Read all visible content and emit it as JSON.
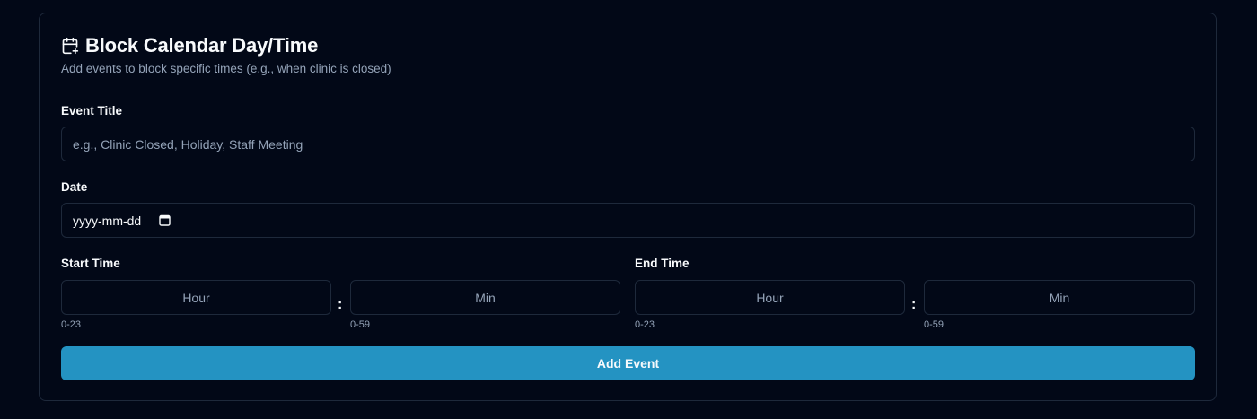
{
  "header": {
    "title": "Block Calendar Day/Time",
    "subtitle": "Add events to block specific times (e.g., when clinic is closed)",
    "icon": "calendar-plus-icon"
  },
  "event_title": {
    "label": "Event Title",
    "placeholder": "e.g., Clinic Closed, Holiday, Staff Meeting",
    "value": ""
  },
  "date": {
    "label": "Date",
    "placeholder": "yyyy-mm-dd",
    "icon": "calendar-icon"
  },
  "start_time": {
    "label": "Start Time",
    "hour_placeholder": "Hour",
    "min_placeholder": "Min",
    "hour_hint": "0-23",
    "min_hint": "0-59",
    "separator": ":"
  },
  "end_time": {
    "label": "End Time",
    "hour_placeholder": "Hour",
    "min_placeholder": "Min",
    "hour_hint": "0-23",
    "min_hint": "0-59",
    "separator": ":"
  },
  "submit": {
    "label": "Add Event"
  },
  "colors": {
    "background": "#020817",
    "border": "#1e293b",
    "muted_text": "#94a3b8",
    "accent": "#2493c2"
  }
}
